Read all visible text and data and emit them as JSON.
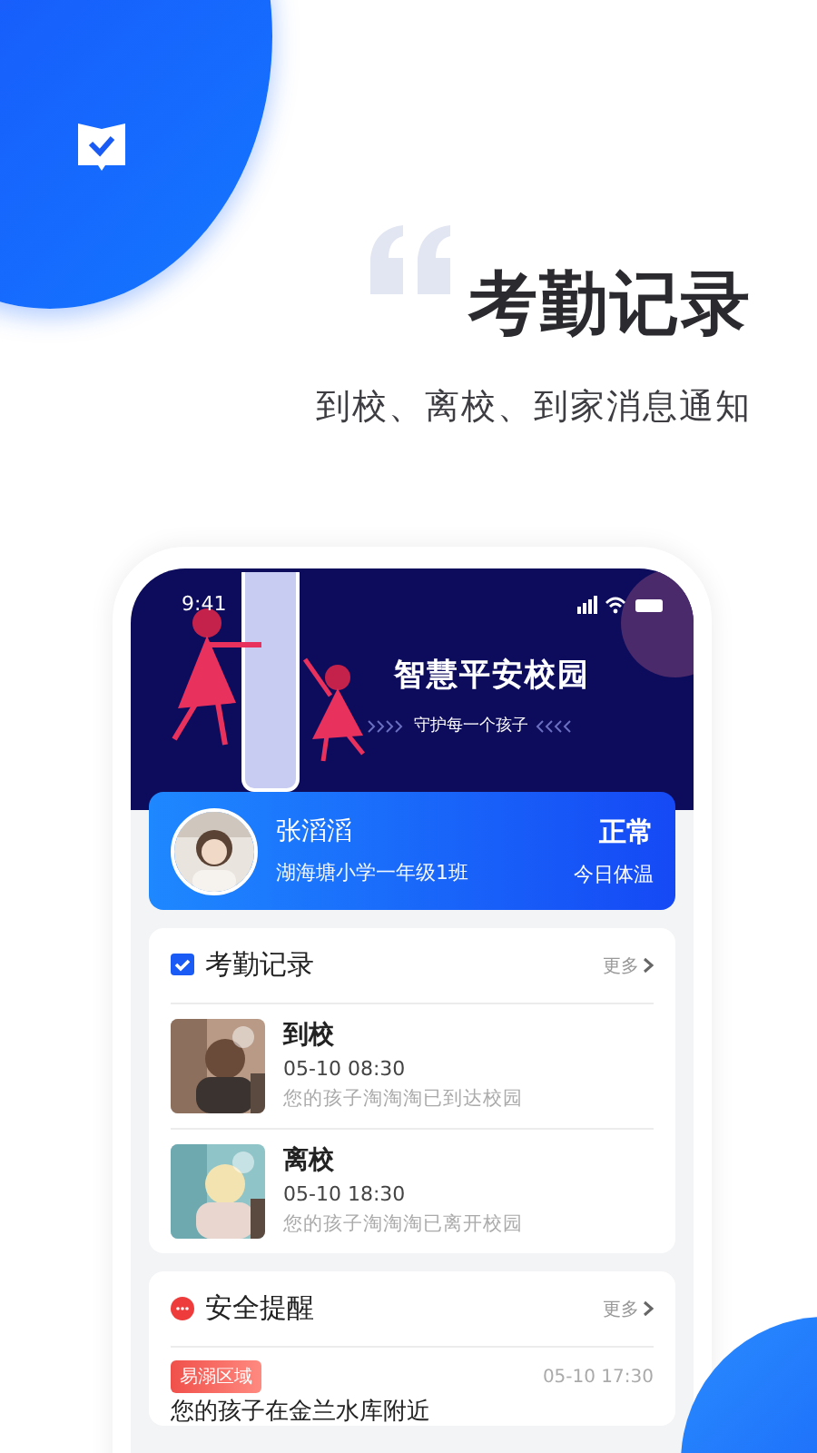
{
  "hero": {
    "title": "考勤记录",
    "subtitle": "到校、离校、到家消息通知"
  },
  "phone": {
    "status_bar": {
      "time": "9:41"
    },
    "banner": {
      "title": "智慧平安校园",
      "subtitle": "守护每一个孩子"
    },
    "student": {
      "name": "张滔滔",
      "class": "湖海塘小学一年级1班",
      "status": "正常",
      "status_label": "今日体温"
    },
    "sections": [
      {
        "kind": "attendance",
        "title": "考勤记录",
        "more": "更多",
        "records": [
          {
            "title": "到校",
            "time": "05-10 08:30",
            "message": "您的孩子淘淘淘已到达校园"
          },
          {
            "title": "离校",
            "time": "05-10 18:30",
            "message": "您的孩子淘淘淘已离开校园"
          }
        ]
      },
      {
        "kind": "alerts",
        "title": "安全提醒",
        "more": "更多",
        "alerts": [
          {
            "tag": "易溺区域",
            "time": "05-10 17:30",
            "message": "您的孩子在金兰水库附近"
          }
        ]
      }
    ]
  }
}
